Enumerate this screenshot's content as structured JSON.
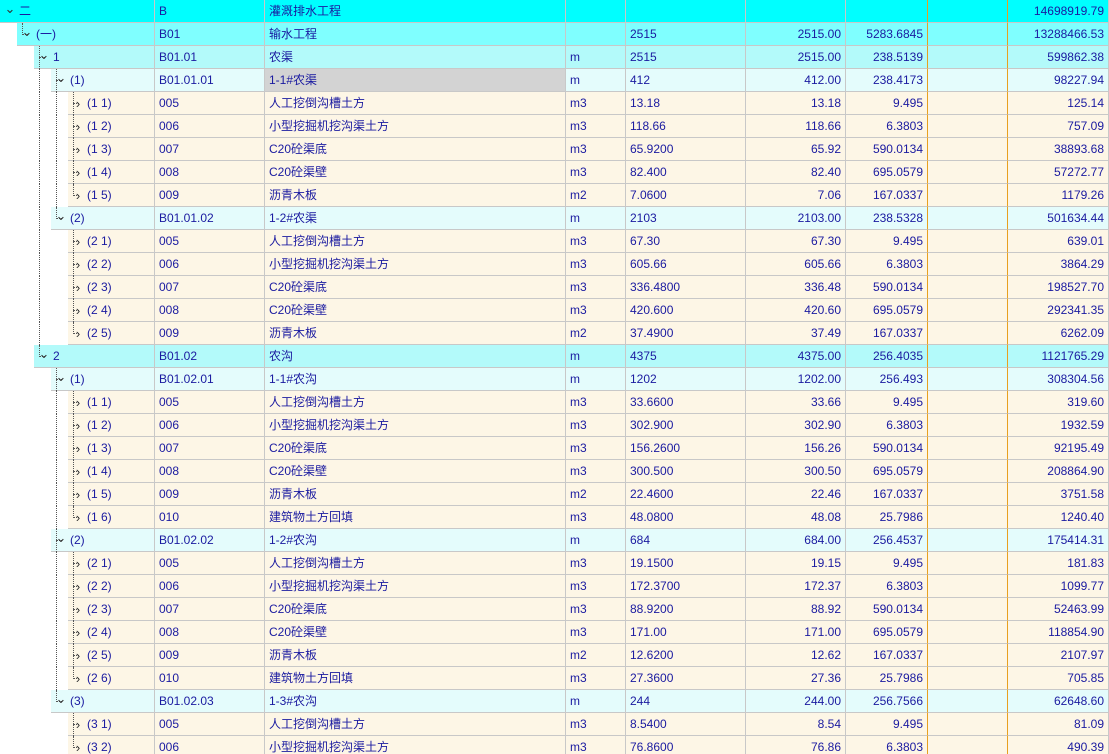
{
  "colors": {
    "lvl0": "#00ffff",
    "lvl1": "#7fffff",
    "lvl2": "#b3fafa",
    "lvl3": "#e4fcfc",
    "leaf": "#fdf6e6",
    "text": "#1a1aa0",
    "orange_divider": "#e8a020"
  },
  "icons": {
    "expanded": "chevron-down-icon",
    "collapsed": "chevron-right-icon"
  },
  "rows": [
    {
      "level": 0,
      "state": "expanded",
      "seq": "二",
      "code": "B",
      "name": "灌溉排水工程",
      "unit": "",
      "qty": "",
      "qty2": "",
      "price": "",
      "amount": "14698919.79"
    },
    {
      "level": 1,
      "state": "expanded",
      "seq": "(一)",
      "code": "B01",
      "name": "输水工程",
      "unit": "",
      "qty": "2515",
      "qty2": "2515.00",
      "price": "5283.6845",
      "amount": "13288466.53"
    },
    {
      "level": 2,
      "state": "expanded",
      "seq": "1",
      "code": "B01.01",
      "name": "农渠",
      "unit": "m",
      "qty": "2515",
      "qty2": "2515.00",
      "price": "238.5139",
      "amount": "599862.38"
    },
    {
      "level": 3,
      "state": "expanded",
      "seq": "(1)",
      "code": "B01.01.01",
      "name": "1-1#农渠",
      "unit": "m",
      "qty": "412",
      "qty2": "412.00",
      "price": "238.4173",
      "amount": "98227.94",
      "selected": true
    },
    {
      "level": 4,
      "state": "collapsed",
      "seq": "(1 1)",
      "code": "005",
      "name": "人工挖倒沟槽土方",
      "unit": "m3",
      "qty": "13.18",
      "qty2": "13.18",
      "price": "9.495",
      "amount": "125.14"
    },
    {
      "level": 4,
      "state": "collapsed",
      "seq": "(1 2)",
      "code": "006",
      "name": "小型挖掘机挖沟渠土方",
      "unit": "m3",
      "qty": "118.66",
      "qty2": "118.66",
      "price": "6.3803",
      "amount": "757.09"
    },
    {
      "level": 4,
      "state": "collapsed",
      "seq": "(1 3)",
      "code": "007",
      "name": "C20砼渠底",
      "unit": "m3",
      "qty": "65.9200",
      "qty2": "65.92",
      "price": "590.0134",
      "amount": "38893.68"
    },
    {
      "level": 4,
      "state": "collapsed",
      "seq": "(1 4)",
      "code": "008",
      "name": "C20砼渠壁",
      "unit": "m3",
      "qty": "82.400",
      "qty2": "82.40",
      "price": "695.0579",
      "amount": "57272.77"
    },
    {
      "level": 4,
      "state": "collapsed",
      "seq": "(1 5)",
      "code": "009",
      "name": "沥青木板",
      "unit": "m2",
      "qty": "7.0600",
      "qty2": "7.06",
      "price": "167.0337",
      "amount": "1179.26"
    },
    {
      "level": 3,
      "state": "expanded",
      "seq": "(2)",
      "code": "B01.01.02",
      "name": "1-2#农渠",
      "unit": "m",
      "qty": "2103",
      "qty2": "2103.00",
      "price": "238.5328",
      "amount": "501634.44"
    },
    {
      "level": 4,
      "state": "collapsed",
      "seq": "(2 1)",
      "code": "005",
      "name": "人工挖倒沟槽土方",
      "unit": "m3",
      "qty": "67.30",
      "qty2": "67.30",
      "price": "9.495",
      "amount": "639.01"
    },
    {
      "level": 4,
      "state": "collapsed",
      "seq": "(2 2)",
      "code": "006",
      "name": "小型挖掘机挖沟渠土方",
      "unit": "m3",
      "qty": "605.66",
      "qty2": "605.66",
      "price": "6.3803",
      "amount": "3864.29"
    },
    {
      "level": 4,
      "state": "collapsed",
      "seq": "(2 3)",
      "code": "007",
      "name": "C20砼渠底",
      "unit": "m3",
      "qty": "336.4800",
      "qty2": "336.48",
      "price": "590.0134",
      "amount": "198527.70"
    },
    {
      "level": 4,
      "state": "collapsed",
      "seq": "(2 4)",
      "code": "008",
      "name": "C20砼渠壁",
      "unit": "m3",
      "qty": "420.600",
      "qty2": "420.60",
      "price": "695.0579",
      "amount": "292341.35"
    },
    {
      "level": 4,
      "state": "collapsed",
      "seq": "(2 5)",
      "code": "009",
      "name": "沥青木板",
      "unit": "m2",
      "qty": "37.4900",
      "qty2": "37.49",
      "price": "167.0337",
      "amount": "6262.09"
    },
    {
      "level": 2,
      "state": "expanded",
      "seq": "2",
      "code": "B01.02",
      "name": "农沟",
      "unit": "m",
      "qty": "4375",
      "qty2": "4375.00",
      "price": "256.4035",
      "amount": "1121765.29"
    },
    {
      "level": 3,
      "state": "expanded",
      "seq": "(1)",
      "code": "B01.02.01",
      "name": "1-1#农沟",
      "unit": "m",
      "qty": "1202",
      "qty2": "1202.00",
      "price": "256.493",
      "amount": "308304.56"
    },
    {
      "level": 4,
      "state": "collapsed",
      "seq": "(1 1)",
      "code": "005",
      "name": "人工挖倒沟槽土方",
      "unit": "m3",
      "qty": "33.6600",
      "qty2": "33.66",
      "price": "9.495",
      "amount": "319.60"
    },
    {
      "level": 4,
      "state": "collapsed",
      "seq": "(1 2)",
      "code": "006",
      "name": "小型挖掘机挖沟渠土方",
      "unit": "m3",
      "qty": "302.900",
      "qty2": "302.90",
      "price": "6.3803",
      "amount": "1932.59"
    },
    {
      "level": 4,
      "state": "collapsed",
      "seq": "(1 3)",
      "code": "007",
      "name": "C20砼渠底",
      "unit": "m3",
      "qty": "156.2600",
      "qty2": "156.26",
      "price": "590.0134",
      "amount": "92195.49"
    },
    {
      "level": 4,
      "state": "collapsed",
      "seq": "(1 4)",
      "code": "008",
      "name": "C20砼渠壁",
      "unit": "m3",
      "qty": "300.500",
      "qty2": "300.50",
      "price": "695.0579",
      "amount": "208864.90"
    },
    {
      "level": 4,
      "state": "collapsed",
      "seq": "(1 5)",
      "code": "009",
      "name": "沥青木板",
      "unit": "m2",
      "qty": "22.4600",
      "qty2": "22.46",
      "price": "167.0337",
      "amount": "3751.58"
    },
    {
      "level": 4,
      "state": "collapsed",
      "seq": "(1 6)",
      "code": "010",
      "name": "建筑物土方回填",
      "unit": "m3",
      "qty": "48.0800",
      "qty2": "48.08",
      "price": "25.7986",
      "amount": "1240.40"
    },
    {
      "level": 3,
      "state": "expanded",
      "seq": "(2)",
      "code": "B01.02.02",
      "name": "1-2#农沟",
      "unit": "m",
      "qty": "684",
      "qty2": "684.00",
      "price": "256.4537",
      "amount": "175414.31"
    },
    {
      "level": 4,
      "state": "collapsed",
      "seq": "(2 1)",
      "code": "005",
      "name": "人工挖倒沟槽土方",
      "unit": "m3",
      "qty": "19.1500",
      "qty2": "19.15",
      "price": "9.495",
      "amount": "181.83"
    },
    {
      "level": 4,
      "state": "collapsed",
      "seq": "(2 2)",
      "code": "006",
      "name": "小型挖掘机挖沟渠土方",
      "unit": "m3",
      "qty": "172.3700",
      "qty2": "172.37",
      "price": "6.3803",
      "amount": "1099.77"
    },
    {
      "level": 4,
      "state": "collapsed",
      "seq": "(2 3)",
      "code": "007",
      "name": "C20砼渠底",
      "unit": "m3",
      "qty": "88.9200",
      "qty2": "88.92",
      "price": "590.0134",
      "amount": "52463.99"
    },
    {
      "level": 4,
      "state": "collapsed",
      "seq": "(2 4)",
      "code": "008",
      "name": "C20砼渠壁",
      "unit": "m3",
      "qty": "171.00",
      "qty2": "171.00",
      "price": "695.0579",
      "amount": "118854.90"
    },
    {
      "level": 4,
      "state": "collapsed",
      "seq": "(2 5)",
      "code": "009",
      "name": "沥青木板",
      "unit": "m2",
      "qty": "12.6200",
      "qty2": "12.62",
      "price": "167.0337",
      "amount": "2107.97"
    },
    {
      "level": 4,
      "state": "collapsed",
      "seq": "(2 6)",
      "code": "010",
      "name": "建筑物土方回填",
      "unit": "m3",
      "qty": "27.3600",
      "qty2": "27.36",
      "price": "25.7986",
      "amount": "705.85"
    },
    {
      "level": 3,
      "state": "expanded",
      "seq": "(3)",
      "code": "B01.02.03",
      "name": "1-3#农沟",
      "unit": "m",
      "qty": "244",
      "qty2": "244.00",
      "price": "256.7566",
      "amount": "62648.60"
    },
    {
      "level": 4,
      "state": "collapsed",
      "seq": "(3 1)",
      "code": "005",
      "name": "人工挖倒沟槽土方",
      "unit": "m3",
      "qty": "8.5400",
      "qty2": "8.54",
      "price": "9.495",
      "amount": "81.09"
    },
    {
      "level": 4,
      "state": "collapsed",
      "seq": "(3 2)",
      "code": "006",
      "name": "小型挖掘机挖沟渠土方",
      "unit": "m3",
      "qty": "76.8600",
      "qty2": "76.86",
      "price": "6.3803",
      "amount": "490.39"
    }
  ]
}
